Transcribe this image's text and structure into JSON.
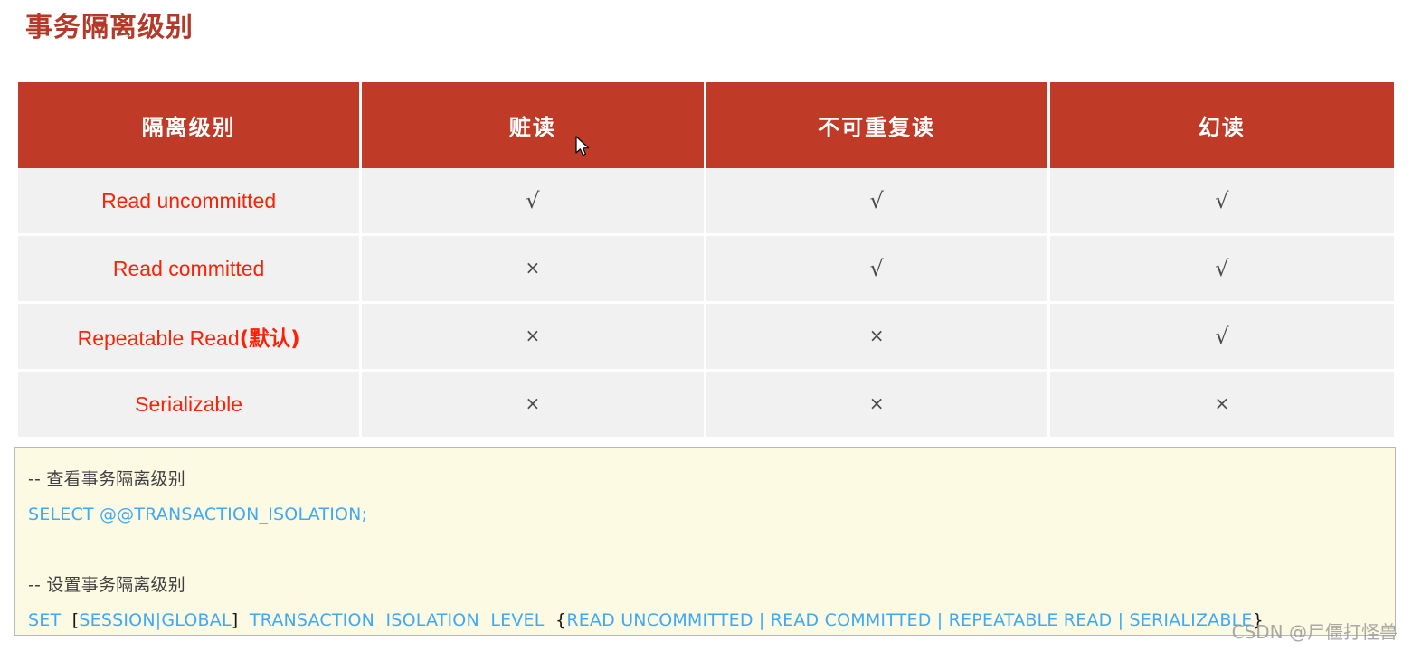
{
  "page": {
    "title": "事务隔离级别"
  },
  "table": {
    "headers": [
      "隔离级别",
      "赃读",
      "不可重复读",
      "幻读"
    ],
    "rows": [
      {
        "level": "Read uncommitted",
        "level_note": "",
        "dirty_read": "√",
        "non_repeatable_read": "√",
        "phantom_read": "√"
      },
      {
        "level": "Read committed",
        "level_note": "",
        "dirty_read": "×",
        "non_repeatable_read": "√",
        "phantom_read": "√"
      },
      {
        "level": "Repeatable Read",
        "level_note": "(默认)",
        "dirty_read": "×",
        "non_repeatable_read": "×",
        "phantom_read": "√"
      },
      {
        "level": "Serializable",
        "level_note": "",
        "dirty_read": "×",
        "non_repeatable_read": "×",
        "phantom_read": "×"
      }
    ]
  },
  "code": {
    "line1_comment": "-- 查看事务隔离级别",
    "line2_sql": "SELECT @@TRANSACTION_ISOLATION;",
    "line4_comment": "-- 设置事务隔离级别",
    "line5": {
      "set": "SET",
      "bracket_open": "[",
      "scope": "SESSION|GLOBAL",
      "bracket_close": "]",
      "transaction": "TRANSACTION",
      "isolation": "ISOLATION",
      "level": "LEVEL",
      "brace_open": "{",
      "options": "READ UNCOMMITTED | READ COMMITTED | REPEATABLE READ | SERIALIZABLE",
      "brace_close": "}"
    }
  },
  "watermark": {
    "text": "CSDN @尸僵打怪兽"
  },
  "colors": {
    "title": "#b33a28",
    "header_bg": "#bf3b27",
    "row_bg": "#f1f1f1",
    "level_text": "#fb2207",
    "code_bg": "#fdfae4",
    "code_keyword": "#3fa9f5",
    "code_comment": "#3f3f3f"
  }
}
